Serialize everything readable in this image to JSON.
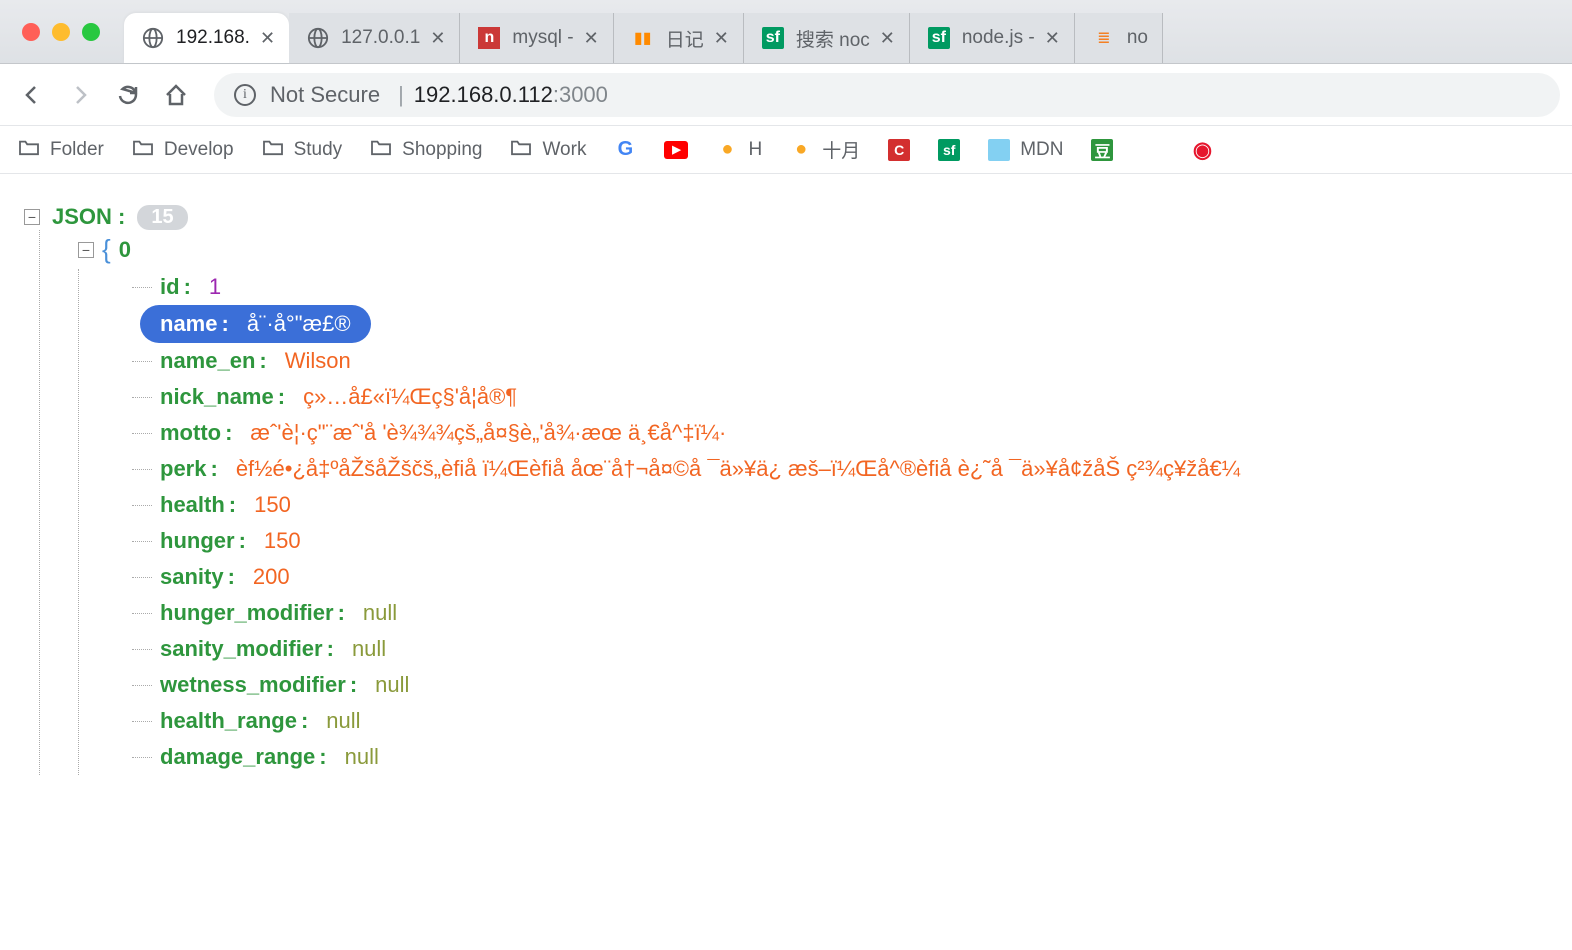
{
  "tabs": [
    {
      "title": "192.168.",
      "active": true,
      "favicon": "globe"
    },
    {
      "title": "127.0.0.1",
      "active": false,
      "favicon": "globe"
    },
    {
      "title": "mysql - ",
      "active": false,
      "favicon": "npm"
    },
    {
      "title": "日记",
      "active": false,
      "favicon": "book"
    },
    {
      "title": "搜索 noc",
      "active": false,
      "favicon": "sf"
    },
    {
      "title": "node.js - ",
      "active": false,
      "favicon": "sf"
    },
    {
      "title": "no",
      "active": false,
      "favicon": "so",
      "noclose": true
    }
  ],
  "address": {
    "not_secure": "Not Secure",
    "host": "192.168.0.112",
    "port": ":3000"
  },
  "bookmarks": [
    {
      "label": "Folder",
      "icon": "folder"
    },
    {
      "label": "Develop",
      "icon": "folder"
    },
    {
      "label": "Study",
      "icon": "folder"
    },
    {
      "label": "Shopping",
      "icon": "folder"
    },
    {
      "label": "Work",
      "icon": "folder"
    },
    {
      "label": "",
      "icon": "google"
    },
    {
      "label": "",
      "icon": "youtube"
    },
    {
      "label": "H",
      "icon": "bean"
    },
    {
      "label": "十月",
      "icon": "bean"
    },
    {
      "label": "",
      "icon": "c"
    },
    {
      "label": "",
      "icon": "sf"
    },
    {
      "label": "MDN",
      "icon": "mdn"
    },
    {
      "label": "",
      "icon": "douban"
    },
    {
      "label": "",
      "icon": "apple"
    },
    {
      "label": "",
      "icon": "weibo"
    }
  ],
  "json": {
    "root_label": "JSON :",
    "root_count": "15",
    "array_index": "0",
    "fields": [
      {
        "key": "id",
        "value": "1",
        "type": "num"
      },
      {
        "key": "name",
        "value": "å¨·å°\"æ£®",
        "type": "str",
        "selected": true
      },
      {
        "key": "name_en",
        "value": "Wilson",
        "type": "str"
      },
      {
        "key": "nick_name",
        "value": "ç»…å£«ï¼Œç§'å¦å®¶",
        "type": "str"
      },
      {
        "key": "motto",
        "value": "æˆ'è¦·ç\"¨æˆ'å   'è¾¾¾çš„å¤§è„'å¾·æœ    ä¸€å^‡ï¼·",
        "type": "str"
      },
      {
        "key": "perk",
        "value": "èf½é•¿å‡ºåŽšåŽščš„èfiå    ï¼Œèfiå    åœ¨å†¬å¤©å    ¯ä»¥ä¿    æš–ï¼Œå^®èfiå    è¿˜å    ¯ä»¥å¢žåŠ  ç²¾ç¥žå€¼",
        "type": "str"
      },
      {
        "key": "health",
        "value": "150",
        "type": "str"
      },
      {
        "key": "hunger",
        "value": "150",
        "type": "str"
      },
      {
        "key": "sanity",
        "value": "200",
        "type": "str"
      },
      {
        "key": "hunger_modifier",
        "value": "null",
        "type": "null"
      },
      {
        "key": "sanity_modifier",
        "value": "null",
        "type": "null"
      },
      {
        "key": "wetness_modifier",
        "value": "null",
        "type": "null"
      },
      {
        "key": "health_range",
        "value": "null",
        "type": "null"
      },
      {
        "key": "damage_range",
        "value": "null",
        "type": "null"
      }
    ]
  }
}
